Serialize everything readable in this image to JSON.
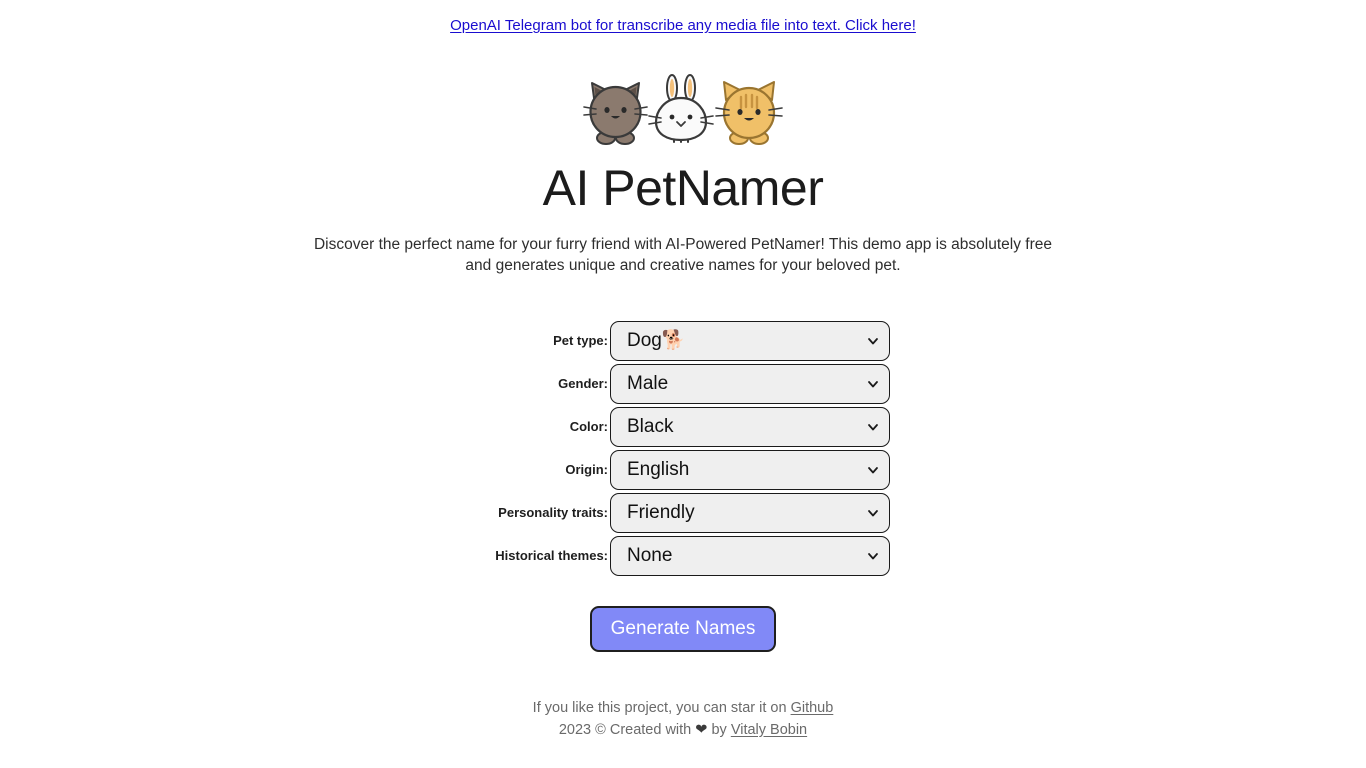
{
  "promo": {
    "link_text": "OpenAI Telegram bot for transcribe any media file into text. Click here!",
    "link_color": "#1a0dcf"
  },
  "hero": {
    "title": "AI PetNamer",
    "description": "Discover the perfect name for your furry friend with AI-Powered PetNamer! This demo app is absolutely free and generates unique and creative names for your beloved pet.",
    "pets": [
      {
        "name": "dog-illustration",
        "body_color": "#8b7a6e",
        "accent_color": "#5d5048"
      },
      {
        "name": "rabbit-illustration",
        "body_color": "#fafafa",
        "accent_color": "#f4c07a"
      },
      {
        "name": "cat-illustration",
        "body_color": "#f0c068",
        "accent_color": "#c79340"
      }
    ]
  },
  "form": {
    "fields": [
      {
        "label": "Pet type:",
        "value": "Dog🐕",
        "name": "pet-type"
      },
      {
        "label": "Gender:",
        "value": "Male",
        "name": "gender"
      },
      {
        "label": "Color:",
        "value": "Black",
        "name": "color"
      },
      {
        "label": "Origin:",
        "value": "English",
        "name": "origin"
      },
      {
        "label": "Personality traits:",
        "value": "Friendly",
        "name": "personality-traits"
      },
      {
        "label": "Historical themes:",
        "value": "None",
        "name": "historical-themes"
      }
    ],
    "submit_label": "Generate Names",
    "submit_color": "#8189f7"
  },
  "footer": {
    "line1_prefix": "If you like this project, you can star it on ",
    "line1_link": "Github",
    "line2_prefix": "2023 © Created with ",
    "line2_heart": "❤",
    "line2_middle": " by ",
    "line2_link": "Vitaly Bobin"
  }
}
